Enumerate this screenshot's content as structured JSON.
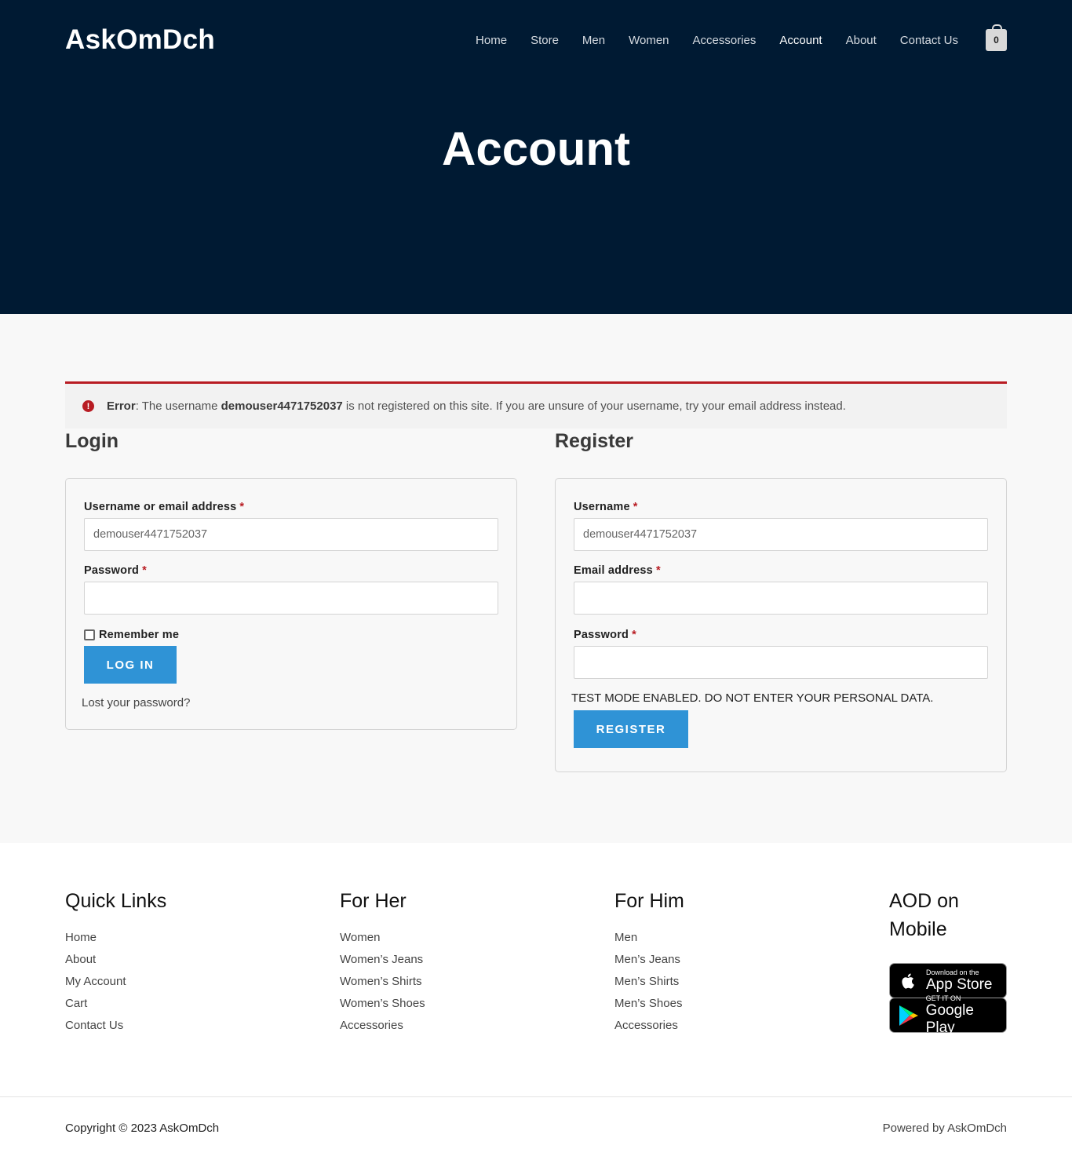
{
  "header": {
    "logo": "AskOmDch",
    "nav": [
      "Home",
      "Store",
      "Men",
      "Women",
      "Accessories",
      "Account",
      "About",
      "Contact Us"
    ],
    "active_nav": "Account",
    "cart_count": "0"
  },
  "hero": {
    "title": "Account"
  },
  "error": {
    "label": "Error",
    "prefix": ": The username ",
    "username": "demouser4471752037",
    "suffix": " is not registered on this site. If you are unsure of your username, try your email address instead."
  },
  "login": {
    "title": "Login",
    "username_label": "Username or email address",
    "username_value": "demouser4471752037",
    "password_label": "Password",
    "required_mark": "*",
    "remember_label": "Remember me",
    "button": "LOG IN",
    "lost_password": "Lost your password?"
  },
  "register": {
    "title": "Register",
    "username_label": "Username",
    "username_value": "demouser4471752037",
    "email_label": "Email address",
    "password_label": "Password",
    "required_mark": "*",
    "test_mode": "TEST MODE ENABLED. DO NOT ENTER YOUR PERSONAL DATA.",
    "button": "REGISTER"
  },
  "footer": {
    "quick_links": {
      "title": "Quick Links",
      "items": [
        "Home",
        "About",
        "My Account",
        "Cart",
        "Contact Us"
      ]
    },
    "for_her": {
      "title": "For Her",
      "items": [
        "Women",
        "Women’s Jeans",
        "Women’s Shirts",
        "Women’s Shoes",
        "Accessories"
      ]
    },
    "for_him": {
      "title": "For Him",
      "items": [
        "Men",
        "Men’s Jeans",
        "Men’s Shirts",
        "Men’s Shoes",
        "Accessories"
      ]
    },
    "mobile": {
      "title": "AOD on Mobile",
      "app_store": {
        "small": "Download on the",
        "big": "App Store"
      },
      "google_play": {
        "small": "GET IT ON",
        "big": "Google Play"
      }
    },
    "copyright": "Copyright © 2023 AskOmDch",
    "powered": "Powered by AskOmDch"
  },
  "colors": {
    "header_bg": "#001a33",
    "button": "#2f93d6",
    "error": "#b81c23"
  }
}
